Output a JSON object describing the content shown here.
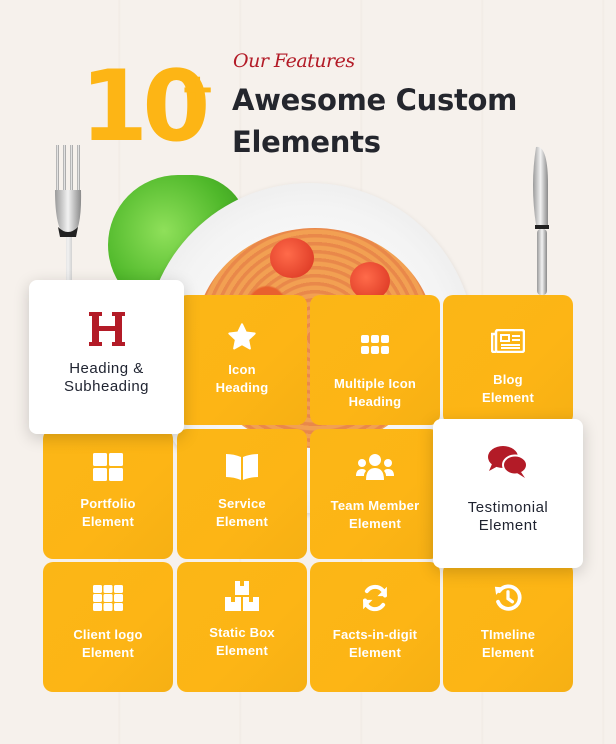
{
  "header": {
    "count": "10",
    "count_suffix": "+",
    "eyebrow": "Our Features",
    "title_line1": "Awesome Custom",
    "title_line2": "Elements"
  },
  "colors": {
    "accent_yellow": "#fdb515",
    "brand_red": "#b31b27",
    "title_dark": "#24262d",
    "background": "#f6f1ec"
  },
  "features": [
    {
      "icon": "heading-h-icon",
      "line1": "Heading &",
      "line2": "Subheading",
      "highlighted": true
    },
    {
      "icon": "star-icon",
      "line1": "Icon",
      "line2": "Heading",
      "highlighted": false
    },
    {
      "icon": "grid-six-icon",
      "line1": "Multiple Icon",
      "line2": "Heading",
      "highlighted": false
    },
    {
      "icon": "newspaper-icon",
      "line1": "Blog",
      "line2": "Element",
      "highlighted": false
    },
    {
      "icon": "portfolio-grid-icon",
      "line1": "Portfolio",
      "line2": "Element",
      "highlighted": false
    },
    {
      "icon": "book-open-icon",
      "line1": "Service",
      "line2": "Element",
      "highlighted": false
    },
    {
      "icon": "users-icon",
      "line1": "Team Member",
      "line2": "Element",
      "highlighted": false
    },
    {
      "icon": "comments-icon",
      "line1": "Testimonial",
      "line2": "Element",
      "highlighted": true
    },
    {
      "icon": "grid-nine-icon",
      "line1": "Client logo",
      "line2": "Element",
      "highlighted": false
    },
    {
      "icon": "boxes-icon",
      "line1": "Static Box",
      "line2": "Element",
      "highlighted": false
    },
    {
      "icon": "sync-icon",
      "line1": "Facts-in-digit",
      "line2": "Element",
      "highlighted": false
    },
    {
      "icon": "history-icon",
      "line1": "TImeline",
      "line2": "Element",
      "highlighted": false
    }
  ]
}
